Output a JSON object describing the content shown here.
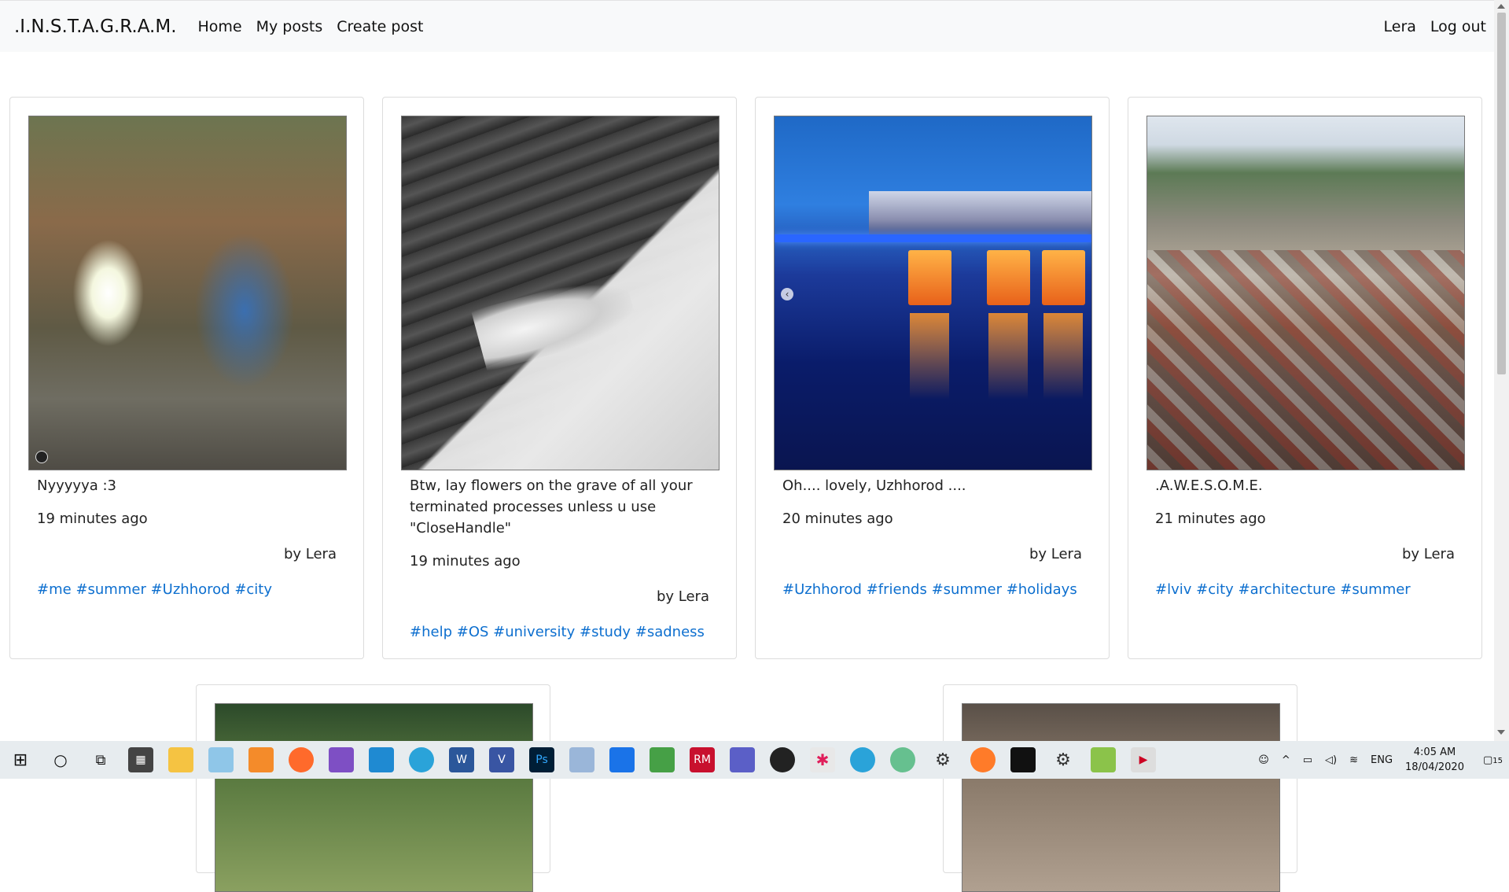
{
  "navbar": {
    "brand": ".I.N.S.T.A.G.R.A.M.",
    "links": [
      "Home",
      "My posts",
      "Create post"
    ],
    "user": "Lera",
    "logout": "Log out"
  },
  "posts": [
    {
      "caption": "Nyyyyya :3",
      "time": "19 minutes ago",
      "author": "by Lera",
      "tags": [
        "#me",
        "#summer",
        "#Uzhhorod",
        "#city"
      ]
    },
    {
      "caption": "Btw, lay flowers on the grave of all your terminated processes unless u use \"CloseHandle\"",
      "time": "19 minutes ago",
      "author": "by Lera",
      "tags": [
        "#help",
        "#OS",
        "#university",
        "#study",
        "#sadness"
      ]
    },
    {
      "caption": "Oh.... lovely, Uzhhorod ....",
      "time": "20 minutes ago",
      "author": "by Lera",
      "tags": [
        "#Uzhhorod",
        "#friends",
        "#summer",
        "#holidays"
      ]
    },
    {
      "caption": ".A.W.E.S.O.M.E.",
      "time": "21 minutes ago",
      "author": "by Lera",
      "tags": [
        "#lviv",
        "#city",
        "#architecture",
        "#summer"
      ]
    }
  ],
  "taskbar": {
    "icons": [
      "windows-start-icon",
      "search-icon",
      "task-view-icon",
      "calculator-icon",
      "file-explorer-icon",
      "notepad-icon",
      "sublime-icon",
      "firefox-icon",
      "visual-studio-icon",
      "vscode-icon",
      "telegram-icon",
      "word-icon",
      "visio-icon",
      "photoshop-icon",
      "paint-icon",
      "blue-app-icon",
      "excel-icon",
      "rubymine-icon",
      "teams-icon",
      "github-icon",
      "slack-icon",
      "telegram-badge-icon",
      "atom-icon",
      "settings-icon",
      "firefox-2-icon",
      "terminal-icon",
      "settings-2-icon",
      "image-editor-icon",
      "video-player-icon"
    ],
    "language": "ENG",
    "time": "4:05 AM",
    "date": "18/04/2020",
    "notifications": "15"
  }
}
